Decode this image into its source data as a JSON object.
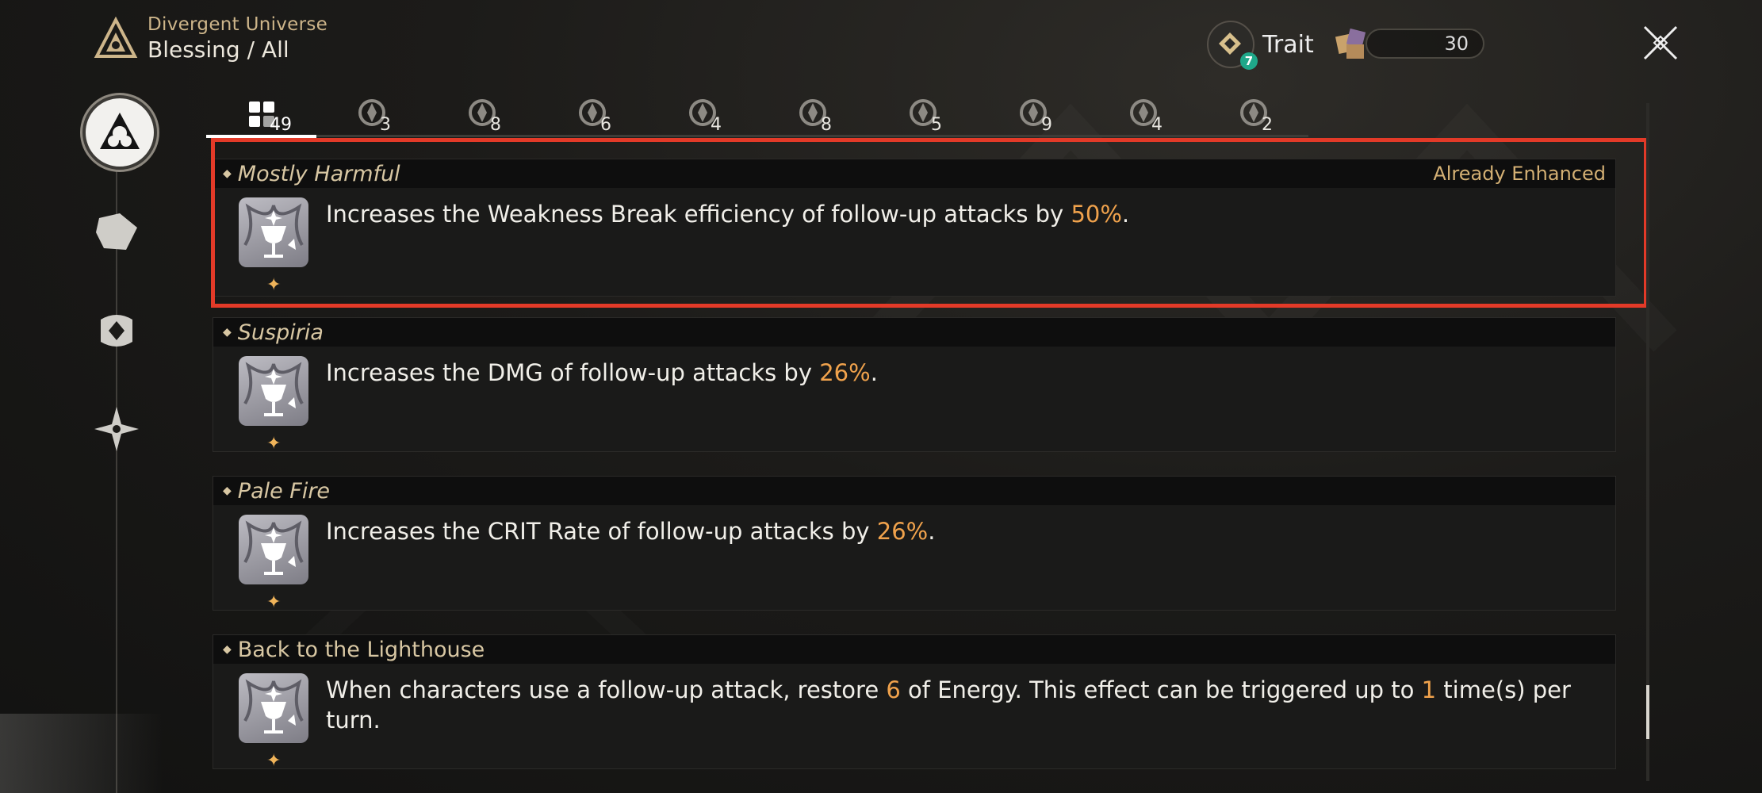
{
  "header": {
    "mode": "Divergent Universe",
    "breadcrumb": "Blessing / All"
  },
  "top_right": {
    "trait_label": "Trait",
    "trait_badge": "7",
    "currency_value": "30"
  },
  "tabs": [
    {
      "icon": "all-grid-icon",
      "count": "49",
      "active": true
    },
    {
      "icon": "preservation-path-icon",
      "count": "3"
    },
    {
      "icon": "remembrance-path-icon",
      "count": "8"
    },
    {
      "icon": "nihility-path-icon",
      "count": "6"
    },
    {
      "icon": "abundance-path-icon",
      "count": "4"
    },
    {
      "icon": "the-hunt-path-icon",
      "count": "8"
    },
    {
      "icon": "destruction-path-icon",
      "count": "5"
    },
    {
      "icon": "elation-path-icon",
      "count": "9"
    },
    {
      "icon": "propagation-path-icon",
      "count": "4"
    },
    {
      "icon": "erudition-path-icon",
      "count": "2"
    }
  ],
  "blessings": [
    {
      "title": "Mostly Harmful",
      "status": "Already Enhanced",
      "desc_a": "Increases the Weakness Break efficiency of follow-up attacks by ",
      "val_1": "50%",
      "desc_b": ".",
      "val_2": "",
      "desc_c": ""
    },
    {
      "title": "Suspiria",
      "status": "",
      "desc_a": "Increases the DMG of follow-up attacks by ",
      "val_1": "26%",
      "desc_b": ".",
      "val_2": "",
      "desc_c": ""
    },
    {
      "title": "Pale Fire",
      "status": "",
      "desc_a": "Increases the CRIT Rate of follow-up attacks by ",
      "val_1": "26%",
      "desc_b": ".",
      "val_2": "",
      "desc_c": ""
    },
    {
      "title": "Back to the Lighthouse",
      "status": "",
      "desc_a": "When characters use a follow-up attack, restore ",
      "val_1": "6",
      "desc_b": " of Energy. This effect can be triggered up to ",
      "val_2": "1",
      "desc_c": " time(s) per turn."
    }
  ],
  "colors": {
    "accent": "#d4b074",
    "highlight_value": "#f0a24c",
    "selection_box": "#e33a28",
    "badge": "#1fa88a"
  }
}
